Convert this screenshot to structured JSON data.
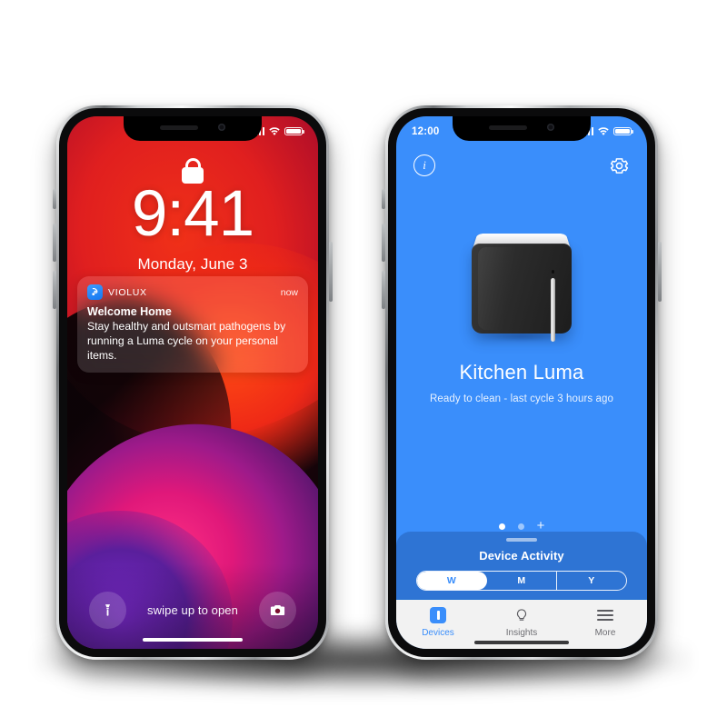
{
  "theme": {
    "blue": "#3a8efb",
    "panel_blue": "#2e74d4",
    "tabbar_bg": "#f2f2f2",
    "inactive_tab": "#6e6e73"
  },
  "left_phone": {
    "name": "lock-screen",
    "status_bar": {
      "time": "",
      "signal_icon": "cellular-signal-icon",
      "wifi_icon": "wifi-icon",
      "battery_icon": "battery-icon"
    },
    "lock_icon": "lock-icon",
    "clock": {
      "time": "9:41",
      "date": "Monday, June 3"
    },
    "notification": {
      "app_icon": "violux-app-icon",
      "app_name": "VIOLUX",
      "time": "now",
      "title": "Welcome Home",
      "body": "Stay healthy and outsmart pathogens by running a Luma cycle on your personal items."
    },
    "bottom": {
      "flashlight_icon": "flashlight-icon",
      "swipe_hint": "swipe up to open",
      "camera_icon": "camera-icon"
    }
  },
  "right_phone": {
    "name": "violux-app",
    "status_bar": {
      "time": "12:00",
      "signal_icon": "cellular-signal-icon",
      "wifi_icon": "wifi-icon",
      "battery_icon": "battery-icon"
    },
    "top_bar": {
      "info_label": "i",
      "info_icon": "info-circle-icon",
      "settings_icon": "gear-icon"
    },
    "device": {
      "image_name": "luma-device-image",
      "title": "Kitchen Luma",
      "status": "Ready to clean - last cycle 3 hours ago"
    },
    "pager": {
      "dots": [
        {
          "active": true
        },
        {
          "active": false
        }
      ],
      "add_label": "+",
      "add_icon": "add-device-icon"
    },
    "activity_panel": {
      "grabber_icon": "drag-handle-icon",
      "title": "Device Activity",
      "segments": [
        {
          "label": "W",
          "active": true
        },
        {
          "label": "M",
          "active": false
        },
        {
          "label": "Y",
          "active": false
        }
      ]
    },
    "tab_bar": {
      "tabs": [
        {
          "label": "Devices",
          "icon": "devices-icon",
          "active": true
        },
        {
          "label": "Insights",
          "icon": "lightbulb-icon",
          "active": false
        },
        {
          "label": "More",
          "icon": "hamburger-icon",
          "active": false
        }
      ]
    }
  }
}
